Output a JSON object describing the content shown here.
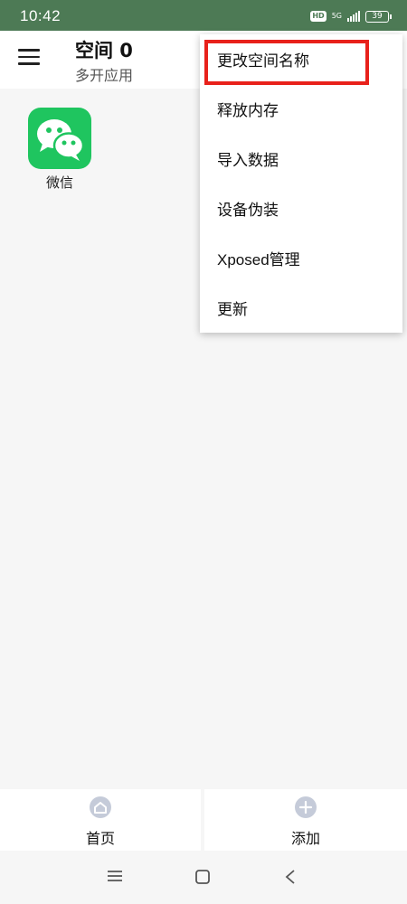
{
  "status_bar": {
    "time": "10:42",
    "hd_badge": "HD",
    "network": "5G",
    "battery": "39"
  },
  "app_bar": {
    "title": "空间 0",
    "subtitle": "多开应用"
  },
  "apps": [
    {
      "label": "微信",
      "icon": "wechat-icon"
    }
  ],
  "menu": {
    "items": [
      {
        "label": "更改空间名称",
        "highlighted": true
      },
      {
        "label": "释放内存"
      },
      {
        "label": "导入数据"
      },
      {
        "label": "设备伪装"
      },
      {
        "label": "Xposed管理"
      },
      {
        "label": "更新"
      }
    ],
    "highlight_color": "#e8211b"
  },
  "bottom_nav": {
    "home_label": "首页",
    "add_label": "添加"
  },
  "colors": {
    "status_bar": "#4d7a55",
    "wechat_green": "#1fc55f",
    "nav_icon": "#c5cbd9"
  }
}
